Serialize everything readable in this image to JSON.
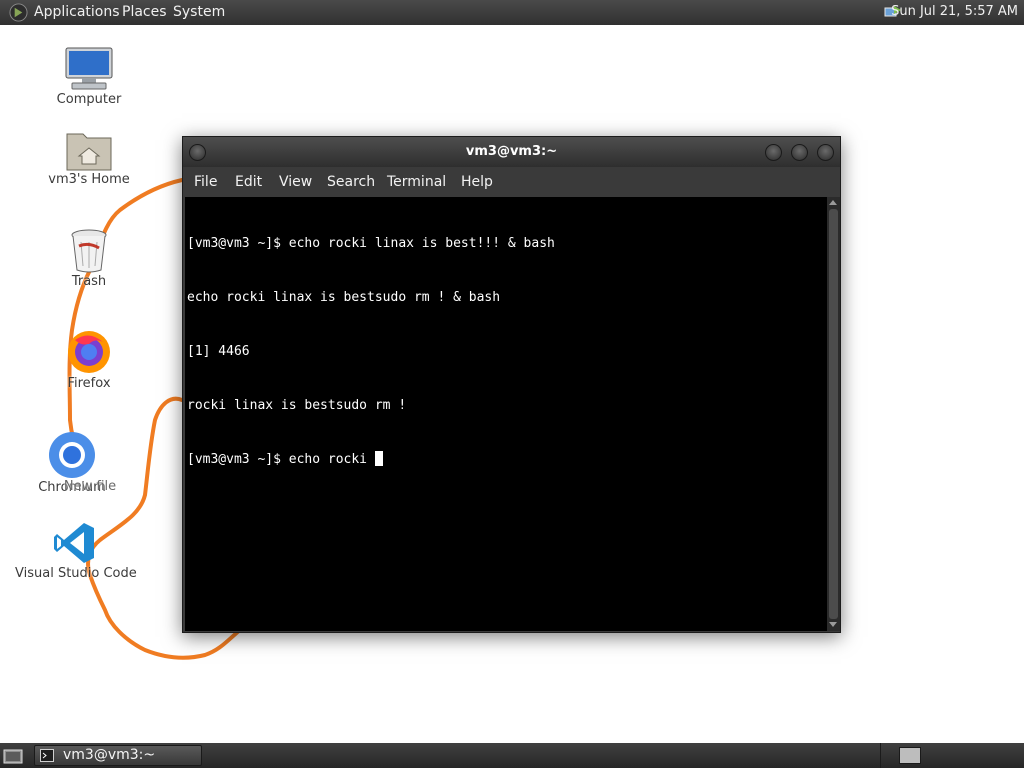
{
  "top_panel": {
    "menus": [
      "Applications",
      "Places",
      "System"
    ],
    "clock": "Sun Jul 21,  5:57 AM",
    "network_icon": "network-icon",
    "apps_icon": "mate-logo-icon"
  },
  "desktop": {
    "icons": [
      {
        "label": "Computer",
        "icon": "computer-icon"
      },
      {
        "label": "vm3's Home",
        "icon": "home-folder-icon"
      },
      {
        "label": "Trash",
        "icon": "trash-icon"
      },
      {
        "label": "Firefox",
        "icon": "firefox-icon"
      },
      {
        "label": "Chromium",
        "icon": "chromium-icon"
      },
      {
        "label": "New file",
        "icon": "file-icon"
      },
      {
        "label": "Visual Studio Code",
        "icon": "vscode-icon"
      }
    ],
    "scribble_color": "#f07c22"
  },
  "terminal": {
    "title": "vm3@vm3:~",
    "menu": [
      "File",
      "Edit",
      "View",
      "Search",
      "Terminal",
      "Help"
    ],
    "lines": [
      "[vm3@vm3 ~]$ echo rocki linax is best!!! & bash",
      "echo rocki linax is bestsudo rm ! & bash",
      "[1] 4466",
      "rocki linax is bestsudo rm !",
      "[vm3@vm3 ~]$ echo rocki "
    ],
    "colors": {
      "background": "#000000",
      "foreground": "#ffffff"
    }
  },
  "bottom_panel": {
    "task_label": "vm3@vm3:~",
    "task_icon": "terminal-icon",
    "show_desktop_icon": "show-desktop-icon",
    "workspace_icon": "workspace-switcher-icon"
  }
}
